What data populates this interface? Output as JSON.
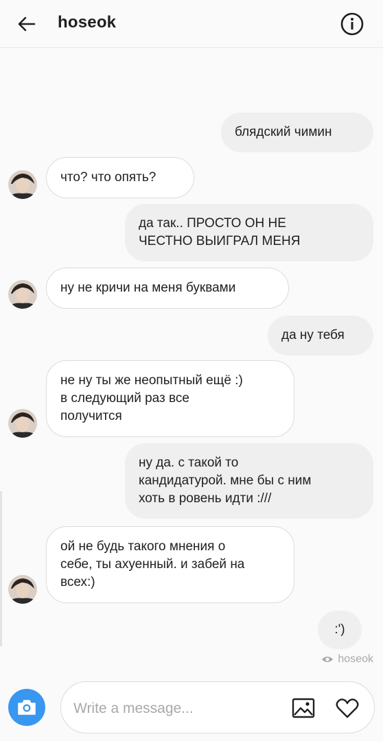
{
  "header": {
    "title": "hoseok",
    "back_icon": "arrow-left-icon",
    "info_icon": "info-circle-icon"
  },
  "messages": [
    {
      "from": "me",
      "text": "блядский чимин"
    },
    {
      "from": "hoseok",
      "text": "что? что опять?"
    },
    {
      "from": "me",
      "text": "да так.. ПРОСТО ОН НЕ\nЧЕСТНО ВЫИГРАЛ МЕНЯ"
    },
    {
      "from": "hoseok",
      "text": "ну не кричи на меня буквами"
    },
    {
      "from": "me",
      "text": "да ну тебя"
    },
    {
      "from": "hoseok",
      "text": "не ну ты же неопытный ещё :)\nв следующий раз все\nполучится"
    },
    {
      "from": "me",
      "text": "ну да. с такой то\nкандидатурой. мне бы с ним\nхоть в ровень идти :///"
    },
    {
      "from": "hoseok",
      "text": "ой не будь такого мнения о\nсебе, ты ахуенный. и забей на\nвсех:)"
    },
    {
      "from": "me",
      "text": ":')"
    }
  ],
  "seen": {
    "icon": "eye-icon",
    "label": "hoseok"
  },
  "composer": {
    "placeholder": "Write a message...",
    "value": "",
    "camera_icon": "camera-icon",
    "gallery_icon": "image-icon",
    "heart_icon": "heart-icon"
  },
  "colors": {
    "accent": "#3897f0",
    "sent_bubble": "#efefef",
    "received_bubble": "#ffffff",
    "muted_text": "#a8a8a8"
  }
}
